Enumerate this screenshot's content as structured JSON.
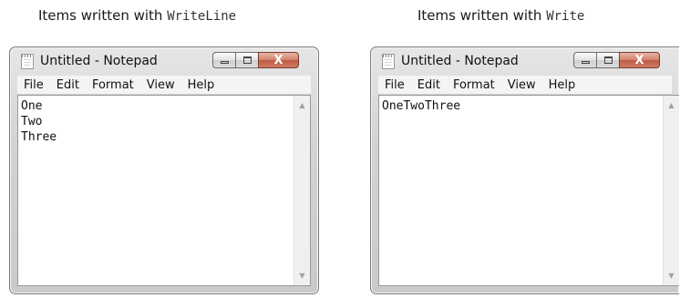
{
  "captions": {
    "left": {
      "prefix": "Items written with ",
      "code": "WriteLine"
    },
    "right": {
      "prefix": "Items written with ",
      "code": "Write"
    }
  },
  "windows": [
    {
      "title": "Untitled - Notepad",
      "menu": [
        "File",
        "Edit",
        "Format",
        "View",
        "Help"
      ],
      "content": "One\nTwo\nThree"
    },
    {
      "title": "Untitled - Notepad",
      "menu": [
        "File",
        "Edit",
        "Format",
        "View",
        "Help"
      ],
      "content": "OneTwoThree"
    }
  ],
  "icons": {
    "close": "x-icon",
    "minimize": "minimize-icon",
    "maximize": "maximize-icon",
    "app": "notepad-icon",
    "scroll_up": "up-arrow-icon",
    "scroll_down": "down-arrow-icon"
  },
  "glyphs": {
    "close": "X",
    "up": "▲",
    "down": "▼"
  },
  "colors": {
    "close_button": "#c8654d",
    "window_frame": "#d3d3d3"
  }
}
